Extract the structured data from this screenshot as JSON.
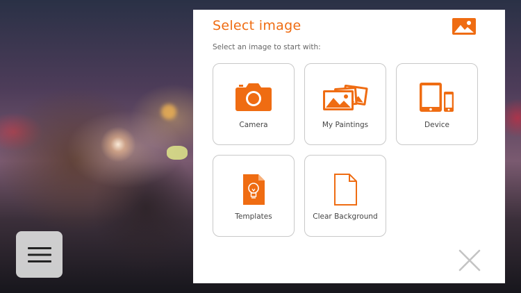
{
  "dialog": {
    "title": "Select image",
    "subtitle": "Select an image to start with:"
  },
  "options": [
    {
      "label": "Camera",
      "icon": "camera-icon"
    },
    {
      "label": "My Paintings",
      "icon": "paintings-icon"
    },
    {
      "label": "Device",
      "icon": "device-icon"
    },
    {
      "label": "Templates",
      "icon": "template-icon"
    },
    {
      "label": "Clear Background",
      "icon": "blank-page-icon"
    }
  ],
  "colors": {
    "accent": "#ef6c12",
    "tile_border": "#c8c8c8",
    "close": "#c4c4c4"
  }
}
